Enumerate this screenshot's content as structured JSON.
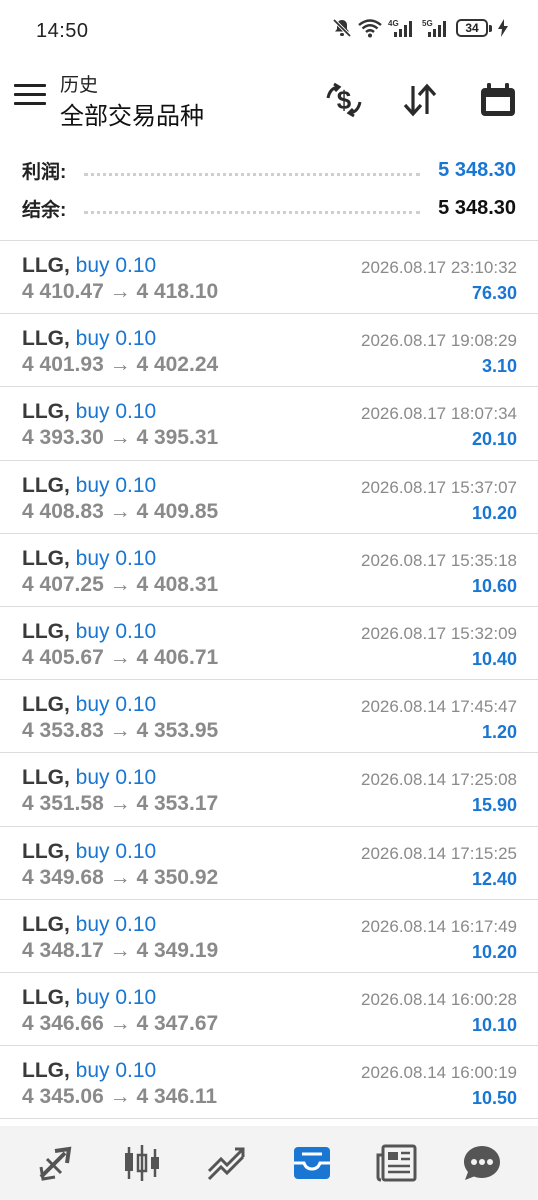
{
  "status": {
    "time": "14:50",
    "battery": "34",
    "net1": "4G",
    "net2": "5G"
  },
  "header": {
    "subtitle": "历史",
    "title": "全部交易品种"
  },
  "summary": {
    "profit_label": "利润:",
    "profit_value": "5 348.30",
    "balance_label": "结余:",
    "balance_value": "5 348.30"
  },
  "trades": [
    {
      "symbol": "LLG,",
      "side": "buy 0.10",
      "open": "4 410.47",
      "close": "4 418.10",
      "time": "2026.08.17 23:10:32",
      "profit": "76.30"
    },
    {
      "symbol": "LLG,",
      "side": "buy 0.10",
      "open": "4 401.93",
      "close": "4 402.24",
      "time": "2026.08.17 19:08:29",
      "profit": "3.10"
    },
    {
      "symbol": "LLG,",
      "side": "buy 0.10",
      "open": "4 393.30",
      "close": "4 395.31",
      "time": "2026.08.17 18:07:34",
      "profit": "20.10"
    },
    {
      "symbol": "LLG,",
      "side": "buy 0.10",
      "open": "4 408.83",
      "close": "4 409.85",
      "time": "2026.08.17 15:37:07",
      "profit": "10.20"
    },
    {
      "symbol": "LLG,",
      "side": "buy 0.10",
      "open": "4 407.25",
      "close": "4 408.31",
      "time": "2026.08.17 15:35:18",
      "profit": "10.60"
    },
    {
      "symbol": "LLG,",
      "side": "buy 0.10",
      "open": "4 405.67",
      "close": "4 406.71",
      "time": "2026.08.17 15:32:09",
      "profit": "10.40"
    },
    {
      "symbol": "LLG,",
      "side": "buy 0.10",
      "open": "4 353.83",
      "close": "4 353.95",
      "time": "2026.08.14 17:45:47",
      "profit": "1.20"
    },
    {
      "symbol": "LLG,",
      "side": "buy 0.10",
      "open": "4 351.58",
      "close": "4 353.17",
      "time": "2026.08.14 17:25:08",
      "profit": "15.90"
    },
    {
      "symbol": "LLG,",
      "side": "buy 0.10",
      "open": "4 349.68",
      "close": "4 350.92",
      "time": "2026.08.14 17:15:25",
      "profit": "12.40"
    },
    {
      "symbol": "LLG,",
      "side": "buy 0.10",
      "open": "4 348.17",
      "close": "4 349.19",
      "time": "2026.08.14 16:17:49",
      "profit": "10.20"
    },
    {
      "symbol": "LLG,",
      "side": "buy 0.10",
      "open": "4 346.66",
      "close": "4 347.67",
      "time": "2026.08.14 16:00:28",
      "profit": "10.10"
    },
    {
      "symbol": "LLG,",
      "side": "buy 0.10",
      "open": "4 345.06",
      "close": "4 346.11",
      "time": "2026.08.14 16:00:19",
      "profit": "10.50"
    }
  ],
  "arrow": "→",
  "icons": {
    "toolbar": [
      "dollar-exchange-icon",
      "sort-icon",
      "calendar-icon"
    ],
    "nav": [
      "quotes-icon",
      "chart-icon",
      "trade-icon",
      "history-icon",
      "news-icon",
      "chat-icon"
    ]
  },
  "colors": {
    "accent": "#1976d2",
    "muted": "#8a8a8a",
    "nav_bg": "#f3f3f3"
  }
}
